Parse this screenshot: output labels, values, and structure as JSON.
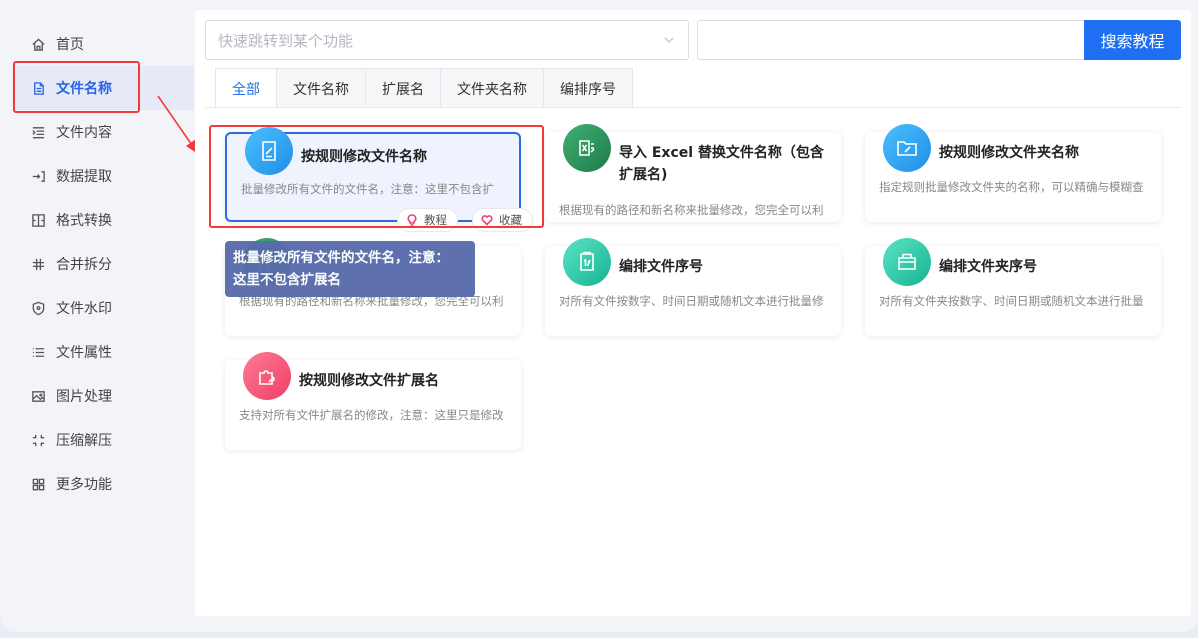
{
  "sidebar": {
    "items": [
      {
        "label": "首页",
        "icon": "home-icon"
      },
      {
        "label": "文件名称",
        "icon": "file-icon"
      },
      {
        "label": "文件内容",
        "icon": "text-indent-icon"
      },
      {
        "label": "数据提取",
        "icon": "extract-icon"
      },
      {
        "label": "格式转换",
        "icon": "convert-icon"
      },
      {
        "label": "合并拆分",
        "icon": "hash-icon"
      },
      {
        "label": "文件水印",
        "icon": "shield-icon"
      },
      {
        "label": "文件属性",
        "icon": "list-icon"
      },
      {
        "label": "图片处理",
        "icon": "image-icon"
      },
      {
        "label": "压缩解压",
        "icon": "compress-icon"
      },
      {
        "label": "更多功能",
        "icon": "grid-icon"
      }
    ],
    "active_index": 1
  },
  "search": {
    "placeholder": "快速跳转到某个功能",
    "button_label": "搜索教程"
  },
  "tabs": [
    "全部",
    "文件名称",
    "扩展名",
    "文件夹名称",
    "编排序号"
  ],
  "active_tab": 0,
  "cards": [
    {
      "title": "按规则修改文件名称",
      "desc": "批量修改所有文件的文件名，注意：这里不包含扩",
      "color": "#2aa3f0",
      "icon": "edit-doc-icon"
    },
    {
      "title": "导入 Excel 替换文件名称（包含",
      "title2": "扩展名)",
      "desc": "根据现有的路径和新名称来批量修改，您完全可以利",
      "color": "#2f9a5f",
      "icon": "excel-icon"
    },
    {
      "title": "按规则修改文件夹名称",
      "desc": "指定规则批量修改文件夹的名称，可以精确与模糊查",
      "color": "#2aa3f0",
      "icon": "folder-edit-icon"
    },
    {
      "title": "",
      "desc": "根据现有的路径和新名称来批量修改，您完全可以利",
      "color": "#2f9a5f",
      "icon": "excel-icon"
    },
    {
      "title": "编排文件序号",
      "desc": "对所有文件按数字、时间日期或随机文本进行批量修",
      "color": "#25c9a8",
      "icon": "number-doc-icon"
    },
    {
      "title": "编排文件夹序号",
      "desc": "对所有文件夹按数字、时间日期或随机文本进行批量",
      "color": "#25c9a8",
      "icon": "folder-number-icon"
    },
    {
      "title": "按规则修改文件扩展名",
      "desc": "支持对所有文件扩展名的修改，注意：这里只是修改",
      "color": "#f34f6e",
      "icon": "puzzle-icon"
    }
  ],
  "card_actions": {
    "tutorial": "教程",
    "favorite": "收藏"
  },
  "tooltip": {
    "line1": "批量修改所有文件的文件名，注意：",
    "line2": "这里不包含扩展名"
  }
}
